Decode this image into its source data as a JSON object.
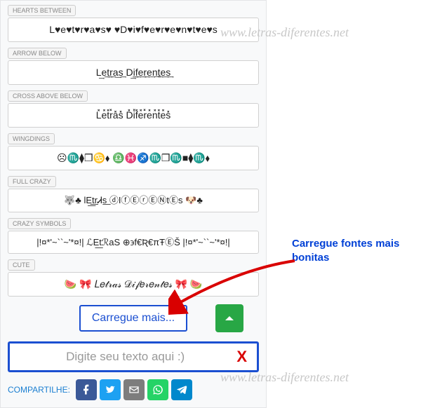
{
  "watermark": "www.letras-diferentes.net",
  "styles": [
    {
      "label": "HEARTS BETWEEN",
      "output": "L♥e♥t♥r♥a♥s♥ ♥D♥i♥f♥e♥r♥e♥n♥t♥e♥s"
    },
    {
      "label": "ARROW BELOW",
      "output": "L͢e͢t͢r͢a͢s͢ D͢i͢f͢e͢r͢e͢n͢t͢e͢s͢"
    },
    {
      "label": "CROSS ABOVE BELOW",
      "output": "L̽e̽t̽r̽a̽s̽ D̽i̽f̽e̽r̽e̽n̽t̽e̽s̽"
    },
    {
      "label": "WINGDINGS",
      "output": "☹♏⧫❒♋⬧ ♎♓♐♏❒♏■⧫♏⬧"
    },
    {
      "label": "FULL CRAZY",
      "output": "🐺♣ lE͟t͟rᏗs͟ ⓓIⓕⒺⓡⒺⓃtⒺs 🐶♣"
    },
    {
      "label": "CRAZY SYMBOLS",
      "output": "|!¤*'~``~'*¤!| ℒE͟tℛaS ⊕϶f€Ʀ€πŦⒺŠ |!¤*'~``~'*¤!|"
    },
    {
      "label": "CUTE",
      "output": "🍉 🎀 𝐿𝑒𝓉𝓇𝒶𝓈 𝒟𝒾𝒻𝑒𝓇𝑒𝓃𝓉𝑒𝓈 🎀 🍉"
    }
  ],
  "load_more": "Carregue mais...",
  "input_placeholder": "Digite seu texto aqui :)",
  "clear_label": "X",
  "share_label": "COMPARTILHE:",
  "share": {
    "facebook": "facebook",
    "twitter": "twitter",
    "email": "email",
    "whatsapp": "whatsapp",
    "telegram": "telegram"
  },
  "annotation": "Carregue fontes mais bonitas"
}
